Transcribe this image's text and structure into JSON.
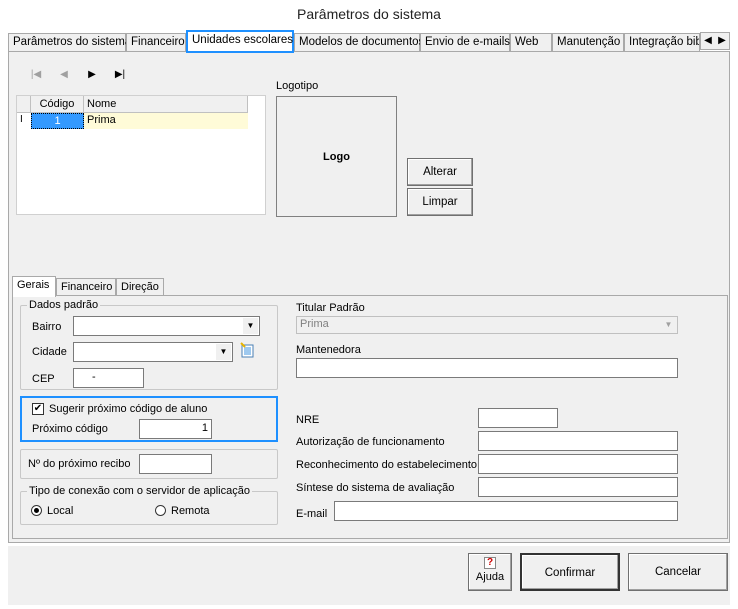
{
  "window": {
    "title": "Parâmetros do sistema"
  },
  "tabs": [
    {
      "label": "Parâmetros do sistema"
    },
    {
      "label": "Financeiro"
    },
    {
      "label": "Unidades escolares"
    },
    {
      "label": "Modelos de documentos"
    },
    {
      "label": "Envio de e-mails"
    },
    {
      "label": "Web"
    },
    {
      "label": "Manutenção"
    },
    {
      "label": "Integração bib"
    }
  ],
  "tab_scroll": {
    "left": "◀",
    "right": "▶"
  },
  "navigator": {
    "first": "|◀",
    "prior": "◀",
    "next": "▶",
    "last": "▶|"
  },
  "grid": {
    "columns": [
      "Código",
      "Nome"
    ],
    "indicator": "I",
    "rows": [
      {
        "codigo": "1",
        "nome": "Prima"
      }
    ]
  },
  "logo": {
    "label": "Logotipo",
    "placeholder": "Logo",
    "change_button": "Alterar",
    "clear_button": "Limpar"
  },
  "subtabs": [
    "Gerais",
    "Financeiro",
    "Direção"
  ],
  "dados_padrao": {
    "legend": "Dados padrão",
    "bairro_label": "Bairro",
    "bairro_value": "",
    "cidade_label": "Cidade",
    "cidade_value": "",
    "cep_label": "CEP",
    "cep_value": "-"
  },
  "sugerir": {
    "checkbox_label": "Sugerir próximo código de aluno",
    "checked": true,
    "proximo_label": "Próximo código",
    "proximo_value": "1"
  },
  "recibo": {
    "label": "Nº do próximo recibo",
    "value": ""
  },
  "conexao": {
    "legend": "Tipo de conexão com o servidor de aplicação",
    "local": "Local",
    "remota": "Remota",
    "selected": "Local"
  },
  "right_fields": {
    "titular_label": "Titular Padrão",
    "titular_value": "Prima",
    "mantenedora_label": "Mantenedora",
    "mantenedora_value": "",
    "nre_label": "NRE",
    "autorizacao_label": "Autorização de funcionamento",
    "reconhecimento_label": "Reconhecimento do estabelecimento",
    "sintese_label": "Síntese do sistema de avaliação",
    "email_label": "E-mail"
  },
  "footer": {
    "help": "Ajuda",
    "help_icon": "?",
    "confirm": "Confirmar",
    "cancel": "Cancelar"
  },
  "colors": {
    "accent": "#1e90ff",
    "selected_row": "#3399ff",
    "row_bg": "#fffbd8",
    "panel": "#f0f0f0"
  }
}
